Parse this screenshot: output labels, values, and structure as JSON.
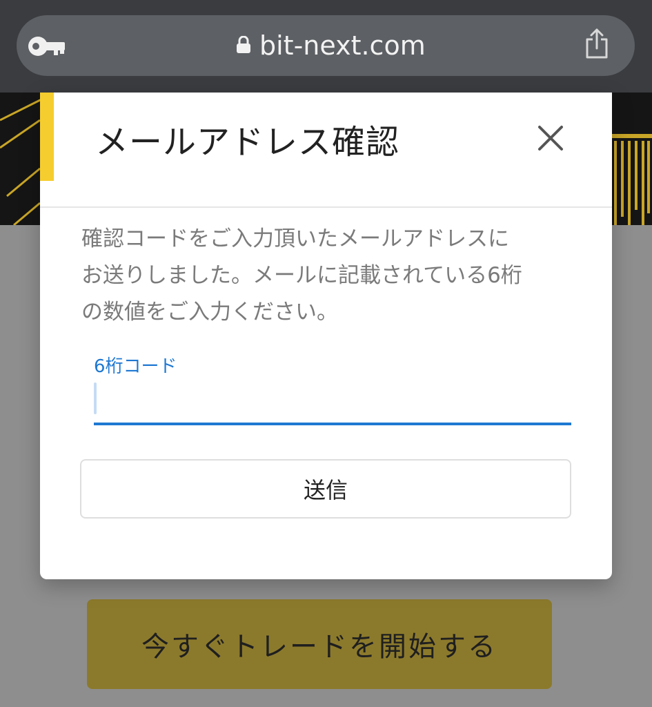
{
  "browser": {
    "url": "bit-next.com",
    "icons": [
      "key-icon",
      "lock-icon",
      "share-icon"
    ]
  },
  "modal": {
    "title": "メールアドレス確認",
    "close_icon": "close-icon",
    "message_lines": [
      "確認コードをご入力頂いたメールアドレスに",
      "お送りしました。メールに記載されている6桁",
      "の数値をご入力ください。"
    ],
    "code_field": {
      "label": "6桁コード",
      "value": ""
    },
    "submit_label": "送信"
  },
  "page": {
    "cta_label": "今すぐトレードを開始する"
  },
  "colors": {
    "accent_yellow": "#f5cd2e",
    "input_blue": "#1e78d2",
    "chrome_dark": "#3a3c40",
    "cta_gold": "#8c7a2c"
  }
}
